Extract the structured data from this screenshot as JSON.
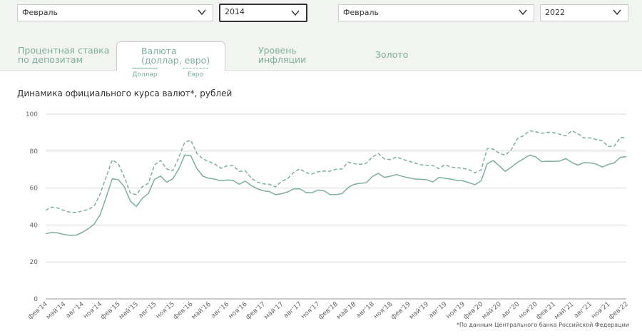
{
  "filters": {
    "from_month": "Февраль",
    "from_year": "2014",
    "to_month": "Февраль",
    "to_year": "2022"
  },
  "tabs": [
    {
      "line1": "Процентная ставка",
      "line2": "по депозитам"
    },
    {
      "line1": "Валюта",
      "line2": "(доллар, евро)"
    },
    {
      "line1": "Уровень",
      "line2": "инфляции"
    },
    {
      "line1": "Золото",
      "line2": ""
    }
  ],
  "chart_title": "Динамика официального курса валют*, рублей",
  "source_note": "*По данным Центрального банка Российской Федерации",
  "colors": {
    "accent": "#7fae9a",
    "grid": "#d9d9d9"
  },
  "chart_data": {
    "type": "line",
    "x": [
      "фев'14",
      "мар'14",
      "апр'14",
      "май'14",
      "июн'14",
      "июл'14",
      "авг'14",
      "сен'14",
      "окт'14",
      "ноя'14",
      "дек'14",
      "янв'15",
      "фев'15",
      "мар'15",
      "апр'15",
      "май'15",
      "июн'15",
      "июл'15",
      "авг'15",
      "сен'15",
      "окт'15",
      "ноя'15",
      "дек'15",
      "янв'16",
      "фев'16",
      "мар'16",
      "апр'16",
      "май'16",
      "июн'16",
      "июл'16",
      "авг'16",
      "сен'16",
      "окт'16",
      "ноя'16",
      "дек'16",
      "янв'17",
      "фев'17",
      "мар'17",
      "апр'17",
      "май'17",
      "июн'17",
      "июл'17",
      "авг'17",
      "сен'17",
      "окт'17",
      "ноя'17",
      "дек'17",
      "янв'18",
      "фев'18",
      "мар'18",
      "апр'18",
      "май'18",
      "июн'18",
      "июл'18",
      "авг'18",
      "сен'18",
      "окт'18",
      "ноя'18",
      "дек'18",
      "янв'19",
      "фев'19",
      "мар'19",
      "апр'19",
      "май'19",
      "июн'19",
      "июл'19",
      "авг'19",
      "сен'19",
      "окт'19",
      "ноя'19",
      "дек'19",
      "янв'20",
      "фев'20",
      "мар'20",
      "апр'20",
      "май'20",
      "июн'20",
      "июл'20",
      "авг'20",
      "сен'20",
      "окт'20",
      "ноя'20",
      "дек'20",
      "янв'21",
      "фев'21",
      "мар'21",
      "апр'21",
      "май'21",
      "июн'21",
      "июл'21",
      "авг'21",
      "сен'21",
      "окт'21",
      "ноя'21",
      "дек'21",
      "янв'22",
      "фев'22"
    ],
    "tick_labels": [
      "фев'14",
      "май'14",
      "авг'14",
      "ноя'14",
      "фев'15",
      "май'15",
      "авг'15",
      "ноя'15",
      "фев'16",
      "май'16",
      "авг'16",
      "ноя'16",
      "фев'17",
      "май'17",
      "авг'17",
      "ноя'17",
      "фев'18",
      "май'18",
      "авг'18",
      "ноя'18",
      "фев'19",
      "май'19",
      "авг'19",
      "ноя'19",
      "фев'20",
      "май'20",
      "авг'20",
      "ноя'20",
      "фев'21",
      "май'21",
      "авг'21",
      "ноя'21",
      "фев'22"
    ],
    "series": [
      {
        "name": "Доллар",
        "style": "solid",
        "values": [
          35.2,
          36.0,
          35.7,
          34.9,
          34.4,
          34.5,
          35.9,
          37.9,
          40.4,
          45.5,
          55.0,
          65.0,
          64.6,
          60.7,
          53.0,
          50.0,
          54.5,
          57.1,
          64.7,
          66.5,
          63.2,
          64.9,
          70.2,
          77.9,
          77.5,
          70.5,
          66.4,
          65.3,
          64.8,
          63.9,
          64.4,
          64.1,
          62.1,
          63.8,
          61.3,
          59.6,
          58.5,
          58.1,
          56.4,
          56.9,
          57.9,
          59.5,
          59.6,
          57.7,
          57.4,
          58.9,
          58.6,
          56.5,
          56.4,
          57.0,
          60.3,
          62.0,
          62.6,
          62.8,
          66.2,
          67.9,
          65.8,
          66.4,
          67.3,
          66.3,
          65.6,
          64.9,
          64.7,
          64.5,
          63.3,
          65.7,
          65.3,
          64.8,
          64.2,
          63.9,
          62.9,
          61.8,
          63.9,
          73.2,
          74.9,
          72.1,
          69.0,
          71.3,
          73.9,
          75.8,
          77.8,
          76.9,
          74.3,
          74.5,
          74.4,
          74.6,
          76.0,
          73.8,
          72.4,
          73.8,
          73.6,
          73.0,
          71.4,
          72.7,
          73.6,
          76.6,
          77.0
        ]
      },
      {
        "name": "Евро",
        "style": "dashed",
        "values": [
          47.9,
          49.7,
          49.2,
          47.9,
          46.9,
          46.8,
          47.5,
          48.4,
          50.1,
          56.7,
          66.0,
          75.2,
          73.2,
          66.0,
          57.3,
          56.4,
          60.8,
          62.6,
          72.5,
          75.0,
          70.4,
          69.3,
          76.4,
          84.8,
          85.9,
          78.8,
          75.7,
          74.4,
          72.9,
          70.7,
          72.0,
          72.1,
          69.0,
          69.4,
          65.3,
          63.2,
          62.3,
          62.0,
          60.6,
          63.6,
          65.1,
          68.5,
          70.4,
          68.4,
          67.6,
          68.8,
          69.2,
          69.1,
          70.1,
          70.4,
          74.0,
          73.2,
          72.8,
          73.4,
          76.8,
          78.7,
          75.8,
          75.4,
          76.8,
          75.6,
          74.6,
          73.6,
          72.6,
          72.3,
          72.2,
          70.5,
          72.6,
          71.3,
          71.0,
          70.7,
          69.9,
          68.3,
          69.8,
          81.3,
          81.1,
          78.8,
          77.8,
          80.8,
          86.8,
          88.3,
          91.0,
          90.5,
          89.6,
          90.2,
          90.0,
          89.1,
          88.3,
          91.0,
          89.4,
          87.1,
          87.2,
          86.3,
          85.6,
          82.5,
          82.6,
          87.3,
          87.3
        ]
      }
    ],
    "ylim": [
      0,
      100
    ],
    "yticks": [
      0,
      20,
      40,
      60,
      80,
      100
    ],
    "grid": true
  }
}
